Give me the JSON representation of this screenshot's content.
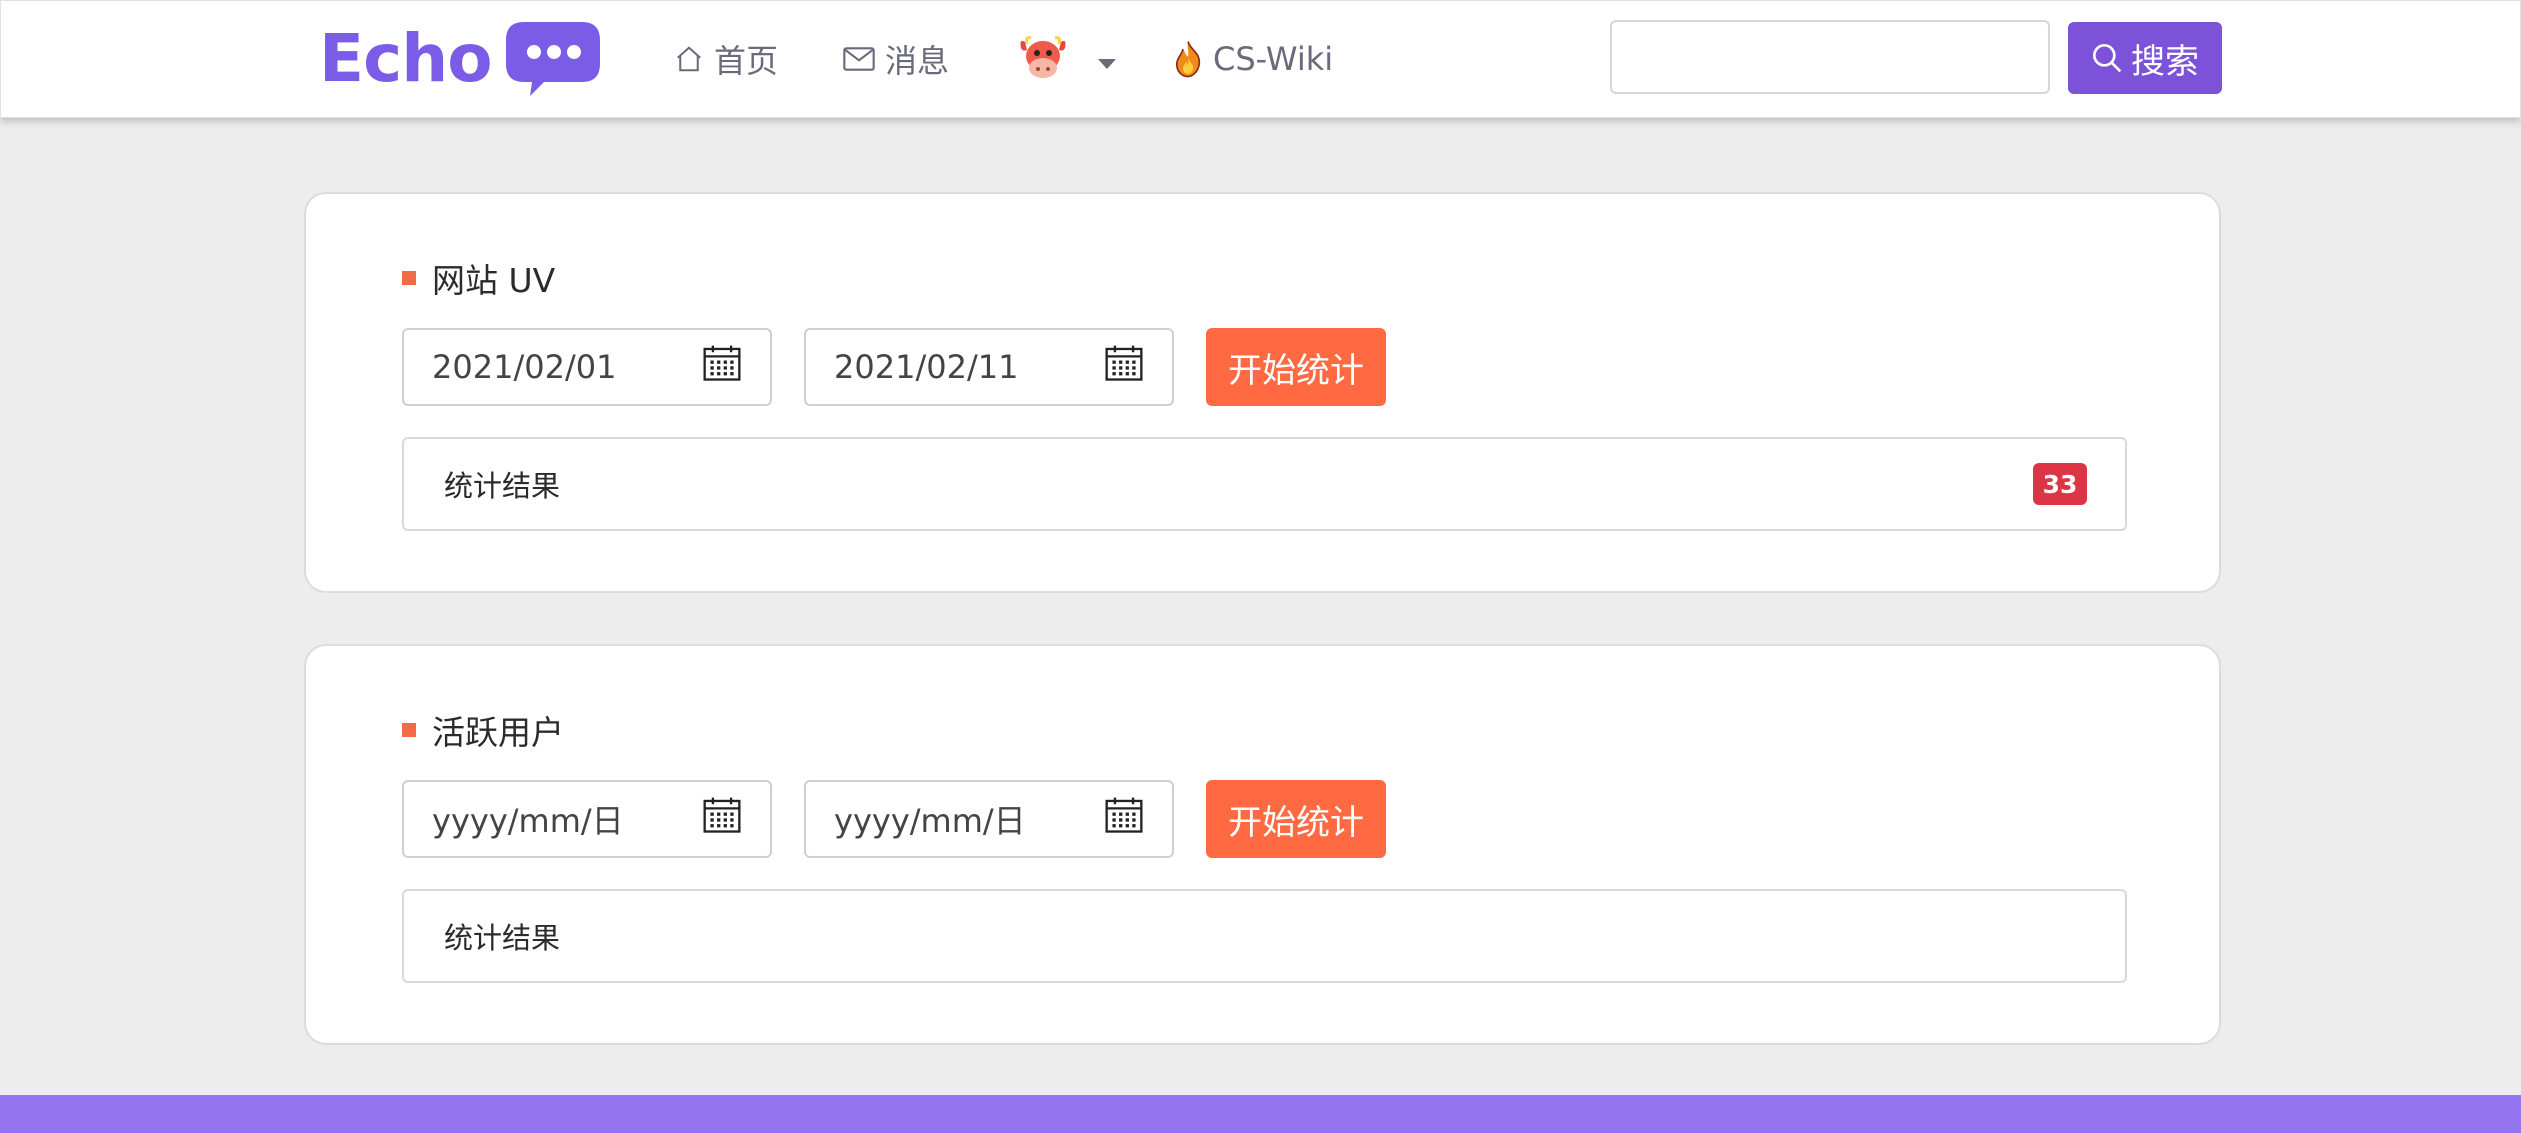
{
  "header": {
    "logo_text": "Echo",
    "nav": {
      "home": "首页",
      "messages": "消息",
      "wiki": "CS-Wiki"
    },
    "search": {
      "value": "",
      "button_label": "搜索"
    }
  },
  "cards": [
    {
      "title": "网站 UV",
      "start_date": "2021/02/01",
      "end_date": "2021/02/11",
      "button_label": "开始统计",
      "result_label": "统计结果",
      "result_count": "33"
    },
    {
      "title": "活跃用户",
      "start_date": "yyyy/mm/日",
      "end_date": "yyyy/mm/日",
      "button_label": "开始统计",
      "result_label": "统计结果"
    }
  ],
  "colors": {
    "brand": "#7b5ce6",
    "search_button": "#7b52d8",
    "accent": "#ff6a43",
    "badge": "#dc3545",
    "footer": "#9574f2"
  },
  "icons": [
    "chat-bubble-icon",
    "home-icon",
    "mail-icon",
    "avatar",
    "caret-down-icon",
    "fire-icon",
    "search-icon",
    "calendar-icon"
  ]
}
